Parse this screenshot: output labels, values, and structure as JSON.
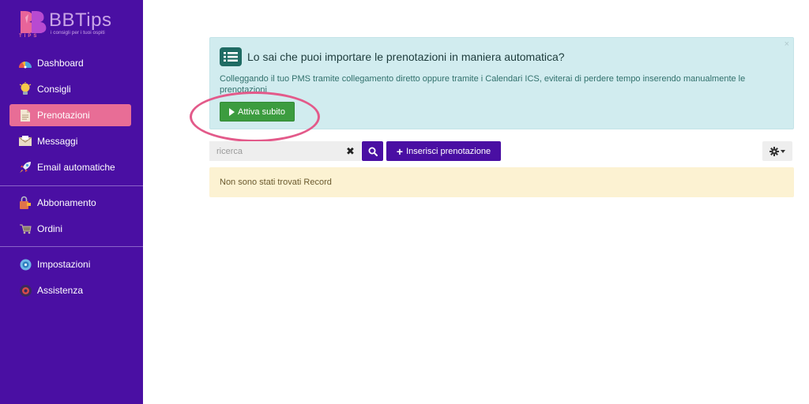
{
  "brand": {
    "name": "BBTips",
    "tagline": "i consigli per i tuoi ospiti",
    "mark_text": "TIPS"
  },
  "sidebar": {
    "items": [
      {
        "label": "Dashboard",
        "icon": "dashboard-icon"
      },
      {
        "label": "Consigli",
        "icon": "lightbulb-icon"
      },
      {
        "label": "Prenotazioni",
        "icon": "document-icon",
        "active": true
      },
      {
        "label": "Messaggi",
        "icon": "envelope-icon"
      },
      {
        "label": "Email automatiche",
        "icon": "rocket-icon"
      },
      {
        "label": "Abbonamento",
        "icon": "lock-icon"
      },
      {
        "label": "Ordini",
        "icon": "cart-icon"
      },
      {
        "label": "Impostazioni",
        "icon": "settings-icon"
      },
      {
        "label": "Assistenza",
        "icon": "support-icon"
      }
    ]
  },
  "alert": {
    "title": "Lo sai che puoi importare le prenotazioni in maniera automatica?",
    "text": "Colleggando il tuo PMS tramite collegamento diretto oppure tramite i Calendari ICS, eviterai di perdere tempo inserendo manualmente le prenotazioni",
    "button_label": "Attiva subito",
    "close": "×"
  },
  "toolbar": {
    "search_placeholder": "ricerca",
    "clear_label": "✖",
    "insert_label": "Inserisci prenotazione"
  },
  "empty_message": "Non sono stati trovati Record",
  "colors": {
    "sidebar_bg": "#4a0fa3",
    "active_item": "#e86d96",
    "primary": "#4a0fa3",
    "success": "#3c9c3f",
    "info_bg": "#d1ecef",
    "warning_bg": "#fcf2d2",
    "highlight_ring": "#e35a8a"
  }
}
